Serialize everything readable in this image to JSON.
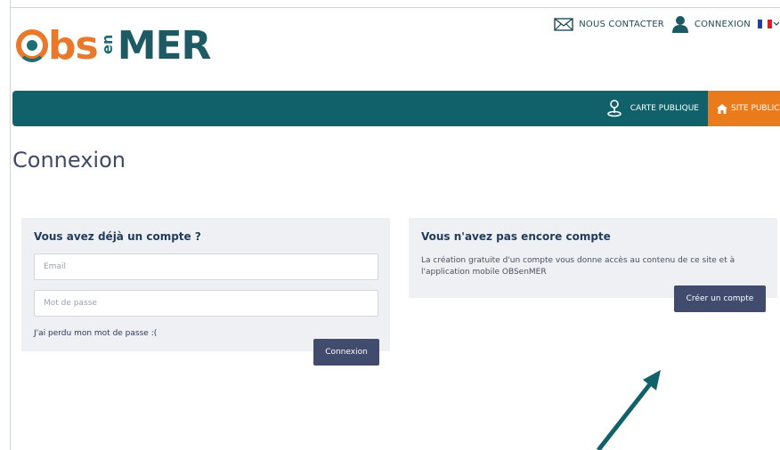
{
  "logo": {
    "prefix": "Obs",
    "en": "en",
    "suffix": "MER"
  },
  "toplinks": {
    "contact": "NOUS CONTACTER",
    "login": "CONNEXION"
  },
  "nav": {
    "carte": "CARTE PUBLIQUE",
    "site": "SITE PUBLIC"
  },
  "page_title": "Connexion",
  "login_panel": {
    "title": "Vous avez déjà un compte ?",
    "email_placeholder": "Email",
    "password_placeholder": "Mot de passe",
    "forgot": "J'ai perdu mon mot de passe :(",
    "submit": "Connexion"
  },
  "create_panel": {
    "title": "Vous n'avez pas encore compte",
    "description": "La création gratuite d'un compte vous donne accès au contenu de ce site et à l'application mobile OBSenMER",
    "submit": "Créer un compte"
  },
  "colors": {
    "teal": "#11616a",
    "orange": "#ea7b1c",
    "button": "#404b6e"
  },
  "icons": [
    "mail-icon",
    "user-icon",
    "flag-fr-icon",
    "chevron-down-icon",
    "map-pin-icon",
    "home-icon",
    "arrow-icon"
  ]
}
